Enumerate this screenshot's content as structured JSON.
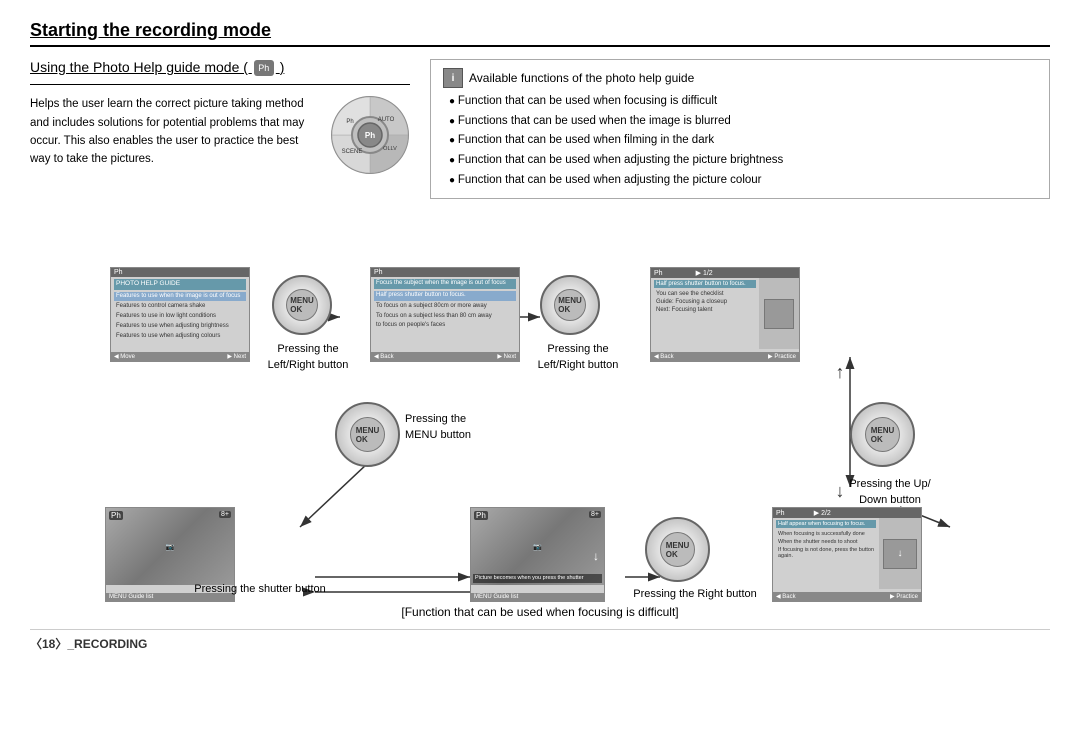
{
  "page": {
    "title": "Starting the recording mode",
    "section_title": "Using the Photo Help guide mode ( ",
    "section_title_suffix": " )",
    "intro": "Helps the user learn the correct picture taking method and includes solutions for potential problems that may occur. This also enables the user to practice the best way to take the pictures.",
    "info_box_title": "Available functions of the photo help guide",
    "info_box_items": [
      "Function that can be used when focusing is difficult",
      "Functions that can be used when the image is blurred",
      "Function that can be used when filming in the dark",
      "Function that can be used when adjusting the picture brightness",
      "Function that can be used when adjusting the picture colour"
    ],
    "diagram_labels": {
      "pressing_left_right_1": "Pressing the\nLeft/Right  button",
      "pressing_menu": "Pressing the\nMENU button",
      "pressing_left_right_2": "Pressing the\nLeft/Right  button",
      "pressing_up_down": "Pressing the Up/\nDown  button",
      "pressing_shutter": "Pressing the shutter button",
      "pressing_right": "Pressing the Right button",
      "function_caption": "[Function that can be used when focusing is difficult]"
    },
    "footer": "〈18〉_RECORDING",
    "screens": {
      "screen1_title": "PHOTO HELP GUIDE",
      "screen1_items": [
        "Features to use when the image is out of focus",
        "Features to control camera shake",
        "Features to use in low light conditions",
        "Features to use when adjusting brightness",
        "Features to use when adjusting colours"
      ],
      "screen1_bottom_left": "◀ Move",
      "screen1_bottom_right": "▶ Next",
      "screen2_title": "Focus the subject when the image is out of focus",
      "screen2_items": [
        "Half press shutter button to focus.",
        "To focus on a subject 80cm or more away",
        "To focus on a subject less than 80 cm away",
        "to focus on people's faces"
      ],
      "screen2_bottom_left": "◀ Back",
      "screen2_bottom_right": "▶ Next",
      "screen3_title": "Half press shutter button to focus.",
      "screen3_items": [
        "You can see the checklist",
        "Guide: Focusing a closeup",
        "Next: Focusing talent"
      ],
      "screen3_bottom_left": "◀ Back",
      "screen3_bottom_right": "▶ Practice",
      "screen4_label": "Picture becomes when\nyou press the shutter",
      "screen4_bottom_left": "MENU Guide list",
      "screen5_title": "Half appear when focusing to focus.",
      "screen5_items": [
        "When focusing is successfully done",
        "When the shutter needs to shoot",
        "If focusing is not done, press the button again."
      ],
      "screen5_bottom_left": "◀ Back",
      "screen5_bottom_right": "▶ Practice"
    }
  }
}
